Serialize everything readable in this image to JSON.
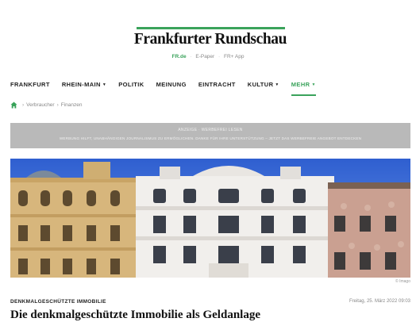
{
  "brand": {
    "name": "Frankfurter Rundschau",
    "accent": "#3aa35b",
    "sublinks": [
      "FR.de",
      "E-Paper",
      "FR+ App"
    ]
  },
  "nav": {
    "items": [
      {
        "label": "FRANKFURT",
        "dropdown": false,
        "active": false
      },
      {
        "label": "RHEIN-MAIN",
        "dropdown": true,
        "active": false
      },
      {
        "label": "POLITIK",
        "dropdown": false,
        "active": false
      },
      {
        "label": "MEINUNG",
        "dropdown": false,
        "active": false
      },
      {
        "label": "EINTRACHT",
        "dropdown": false,
        "active": false
      },
      {
        "label": "KULTUR",
        "dropdown": true,
        "active": false
      },
      {
        "label": "MEHR",
        "dropdown": true,
        "active": true
      }
    ]
  },
  "breadcrumb": {
    "icon": "home-icon",
    "items": [
      "Verbraucher",
      "Finanzen"
    ]
  },
  "ad": {
    "title": "ANZEIGE · WERBEFREI LESEN",
    "text": "WERBUNG HILFT, UNABHÄNGIGEN JOURNALISMUS ZU ERMÖGLICHEN. DANKE FÜR IHRE UNTERSTÜTZUNG – JETZT DAS WERBEFREIE ANGEBOT ENTDECKEN"
  },
  "article": {
    "image_credit": "© Imago",
    "kicker": "DENKMALGESCHÜTZTE IMMOBILIE",
    "date": "Freitag, 25. März 2022 09:03",
    "headline": "Die denkmalgeschützte Immobilie als Geldanlage"
  }
}
